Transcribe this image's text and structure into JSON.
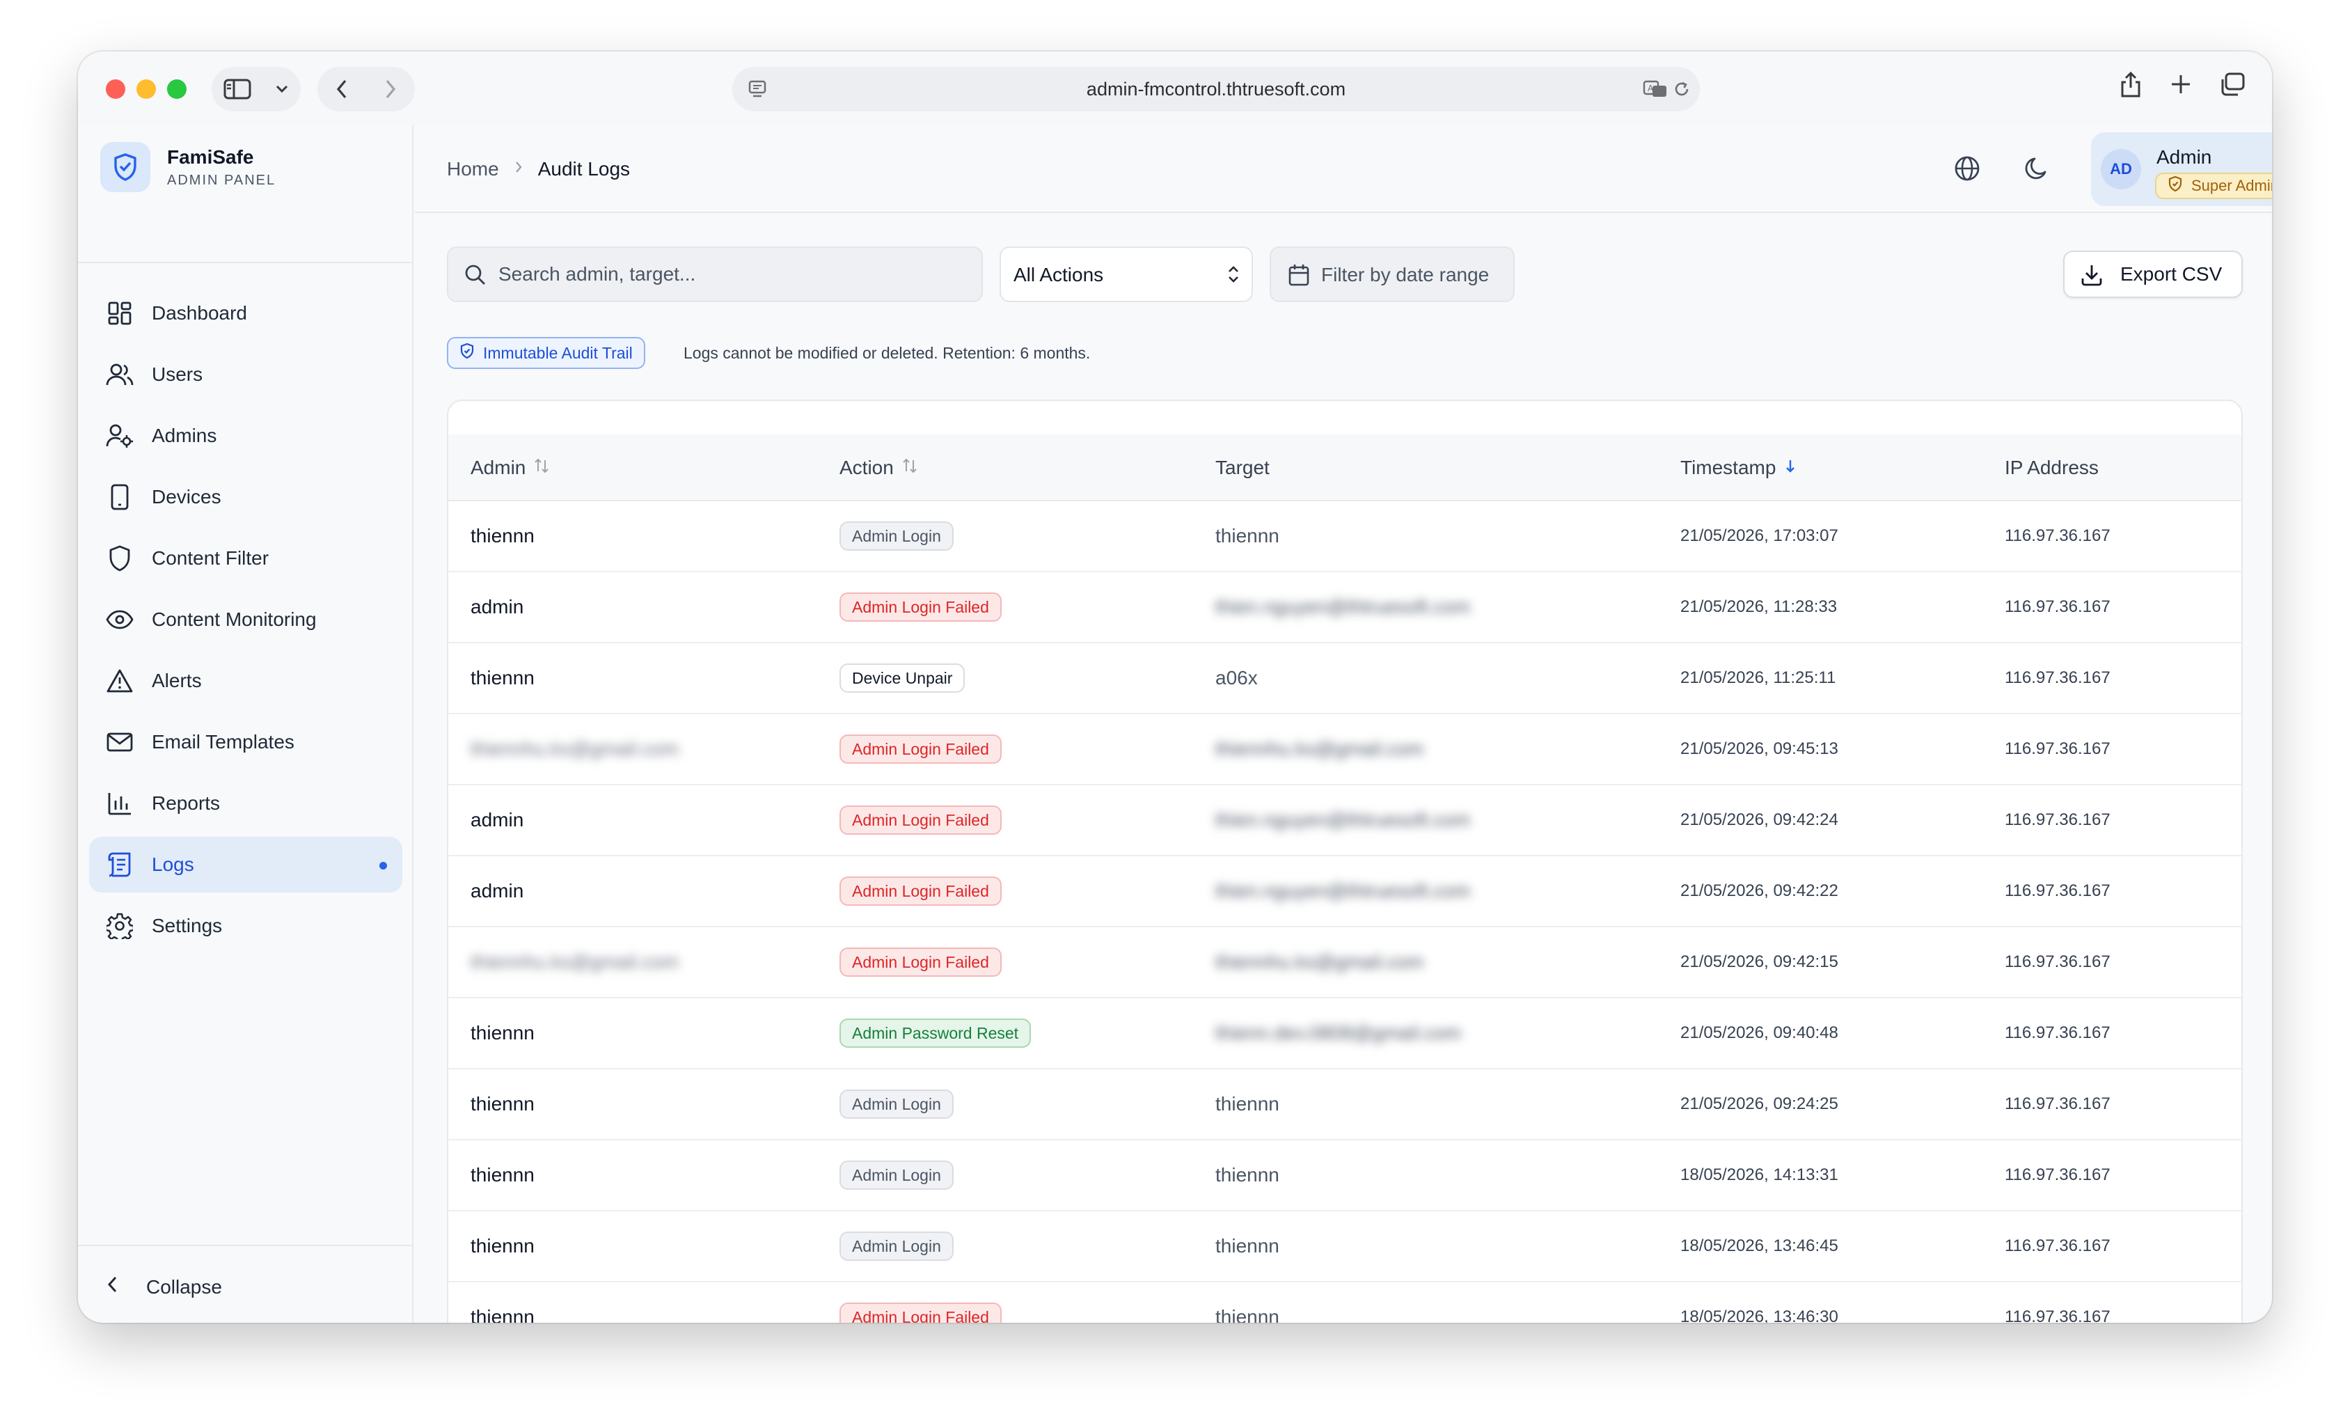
{
  "browser": {
    "url": "admin-fmcontrol.thtruesoft.com"
  },
  "brand": {
    "name": "FamiSafe",
    "subtitle": "ADMIN PANEL"
  },
  "sidebar": {
    "items": [
      {
        "label": "Dashboard",
        "icon": "dashboard-icon"
      },
      {
        "label": "Users",
        "icon": "users-icon"
      },
      {
        "label": "Admins",
        "icon": "admin-user-icon"
      },
      {
        "label": "Devices",
        "icon": "device-icon"
      },
      {
        "label": "Content Filter",
        "icon": "shield-icon"
      },
      {
        "label": "Content Monitoring",
        "icon": "eye-icon"
      },
      {
        "label": "Alerts",
        "icon": "alert-triangle-icon"
      },
      {
        "label": "Email Templates",
        "icon": "mail-icon"
      },
      {
        "label": "Reports",
        "icon": "bar-chart-icon"
      },
      {
        "label": "Logs",
        "icon": "logs-scroll-icon",
        "active": true
      },
      {
        "label": "Settings",
        "icon": "gear-icon"
      }
    ],
    "collapse_label": "Collapse"
  },
  "header": {
    "breadcrumb_home": "Home",
    "breadcrumb_current": "Audit Logs",
    "user_initials": "AD",
    "user_name": "Admin",
    "user_role": "Super Admin"
  },
  "toolbar": {
    "search_placeholder": "Search admin, target...",
    "action_filter": "All Actions",
    "date_filter": "Filter by date range",
    "export_label": "Export CSV"
  },
  "notice": {
    "badge": "Immutable Audit Trail",
    "text": "Logs cannot be modified or deleted. Retention: 6 months."
  },
  "table": {
    "columns": [
      "Admin",
      "Action",
      "Target",
      "Timestamp",
      "IP Address"
    ],
    "rows": [
      {
        "admin": "thiennn",
        "action": "Admin Login",
        "tone": "gray",
        "target": "thiennn",
        "timestamp": "21/05/2026, 17:03:07",
        "ip": "116.97.36.167"
      },
      {
        "admin": "admin",
        "action": "Admin Login Failed",
        "tone": "red",
        "target": "thien.nguyen@thtruesoft.com",
        "target_blurred": true,
        "timestamp": "21/05/2026, 11:28:33",
        "ip": "116.97.36.167"
      },
      {
        "admin": "thiennn",
        "action": "Device Unpair",
        "tone": "white",
        "target": "a06x",
        "timestamp": "21/05/2026, 11:25:11",
        "ip": "116.97.36.167"
      },
      {
        "admin": "thiennhu.ks@gmail.com",
        "admin_blurred": true,
        "action": "Admin Login Failed",
        "tone": "red",
        "target": "thiennhu.ks@gmail.com",
        "target_blurred": true,
        "timestamp": "21/05/2026, 09:45:13",
        "ip": "116.97.36.167"
      },
      {
        "admin": "admin",
        "action": "Admin Login Failed",
        "tone": "red",
        "target": "thien.nguyen@thtruesoft.com",
        "target_blurred": true,
        "timestamp": "21/05/2026, 09:42:24",
        "ip": "116.97.36.167"
      },
      {
        "admin": "admin",
        "action": "Admin Login Failed",
        "tone": "red",
        "target": "thien.nguyen@thtruesoft.com",
        "target_blurred": true,
        "timestamp": "21/05/2026, 09:42:22",
        "ip": "116.97.36.167"
      },
      {
        "admin": "thiennhu.ks@gmail.com",
        "admin_blurred": true,
        "action": "Admin Login Failed",
        "tone": "red",
        "target": "thiennhu.ks@gmail.com",
        "target_blurred": true,
        "timestamp": "21/05/2026, 09:42:15",
        "ip": "116.97.36.167"
      },
      {
        "admin": "thiennn",
        "action": "Admin Password Reset",
        "tone": "green",
        "target": "thienn.dev.0808@gmail.com",
        "target_blurred": true,
        "timestamp": "21/05/2026, 09:40:48",
        "ip": "116.97.36.167"
      },
      {
        "admin": "thiennn",
        "action": "Admin Login",
        "tone": "gray",
        "target": "thiennn",
        "timestamp": "21/05/2026, 09:24:25",
        "ip": "116.97.36.167"
      },
      {
        "admin": "thiennn",
        "action": "Admin Login",
        "tone": "gray",
        "target": "thiennn",
        "timestamp": "18/05/2026, 14:13:31",
        "ip": "116.97.36.167"
      },
      {
        "admin": "thiennn",
        "action": "Admin Login",
        "tone": "gray",
        "target": "thiennn",
        "timestamp": "18/05/2026, 13:46:45",
        "ip": "116.97.36.167"
      },
      {
        "admin": "thiennn",
        "action": "Admin Login Failed",
        "tone": "red",
        "target": "thiennn",
        "timestamp": "18/05/2026, 13:46:30",
        "ip": "116.97.36.167"
      }
    ]
  },
  "colors": {
    "accent": "#2563eb",
    "active_nav_bg": "#e2ebf8",
    "danger": "#dc2626",
    "success": "#15803d",
    "warning": "#a16207"
  }
}
